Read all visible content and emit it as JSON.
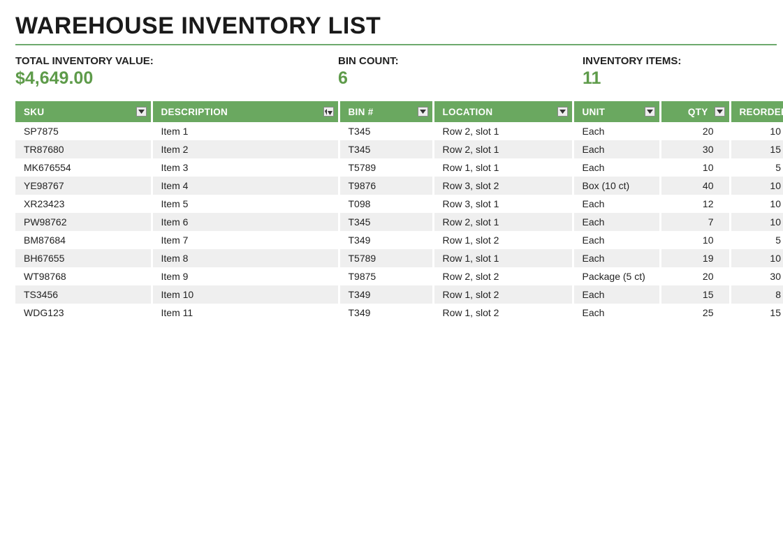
{
  "page_title": "WAREHOUSE INVENTORY LIST",
  "summary": {
    "total_label": "TOTAL INVENTORY VALUE:",
    "total_value": "$4,649.00",
    "bins_label": "BIN COUNT:",
    "bins_value": "6",
    "items_label": "INVENTORY ITEMS:",
    "items_value": "11"
  },
  "columns": {
    "sku": "SKU",
    "description": "DESCRIPTION",
    "bin": "BIN #",
    "location": "LOCATION",
    "unit": "UNIT",
    "qty": "QTY",
    "reorder": "REORDER"
  },
  "rows": [
    {
      "sku": "SP7875",
      "description": "Item 1",
      "bin": "T345",
      "location": "Row 2, slot 1",
      "unit": "Each",
      "qty": "20",
      "reorder": "10"
    },
    {
      "sku": "TR87680",
      "description": "Item 2",
      "bin": "T345",
      "location": "Row 2, slot 1",
      "unit": "Each",
      "qty": "30",
      "reorder": "15"
    },
    {
      "sku": "MK676554",
      "description": "Item 3",
      "bin": "T5789",
      "location": "Row 1, slot 1",
      "unit": "Each",
      "qty": "10",
      "reorder": "5"
    },
    {
      "sku": "YE98767",
      "description": "Item 4",
      "bin": "T9876",
      "location": "Row 3, slot 2",
      "unit": "Box (10 ct)",
      "qty": "40",
      "reorder": "10"
    },
    {
      "sku": "XR23423",
      "description": "Item 5",
      "bin": "T098",
      "location": "Row 3, slot 1",
      "unit": "Each",
      "qty": "12",
      "reorder": "10"
    },
    {
      "sku": "PW98762",
      "description": "Item 6",
      "bin": "T345",
      "location": "Row 2, slot 1",
      "unit": "Each",
      "qty": "7",
      "reorder": "10"
    },
    {
      "sku": "BM87684",
      "description": "Item 7",
      "bin": "T349",
      "location": "Row 1, slot 2",
      "unit": "Each",
      "qty": "10",
      "reorder": "5"
    },
    {
      "sku": "BH67655",
      "description": "Item 8",
      "bin": "T5789",
      "location": "Row 1, slot 1",
      "unit": "Each",
      "qty": "19",
      "reorder": "10"
    },
    {
      "sku": "WT98768",
      "description": "Item 9",
      "bin": "T9875",
      "location": "Row 2, slot 2",
      "unit": "Package (5 ct)",
      "qty": "20",
      "reorder": "30"
    },
    {
      "sku": "TS3456",
      "description": "Item 10",
      "bin": "T349",
      "location": "Row 1, slot 2",
      "unit": "Each",
      "qty": "15",
      "reorder": "8"
    },
    {
      "sku": "WDG123",
      "description": "Item 11",
      "bin": "T349",
      "location": "Row 1, slot 2",
      "unit": "Each",
      "qty": "25",
      "reorder": "15"
    }
  ]
}
